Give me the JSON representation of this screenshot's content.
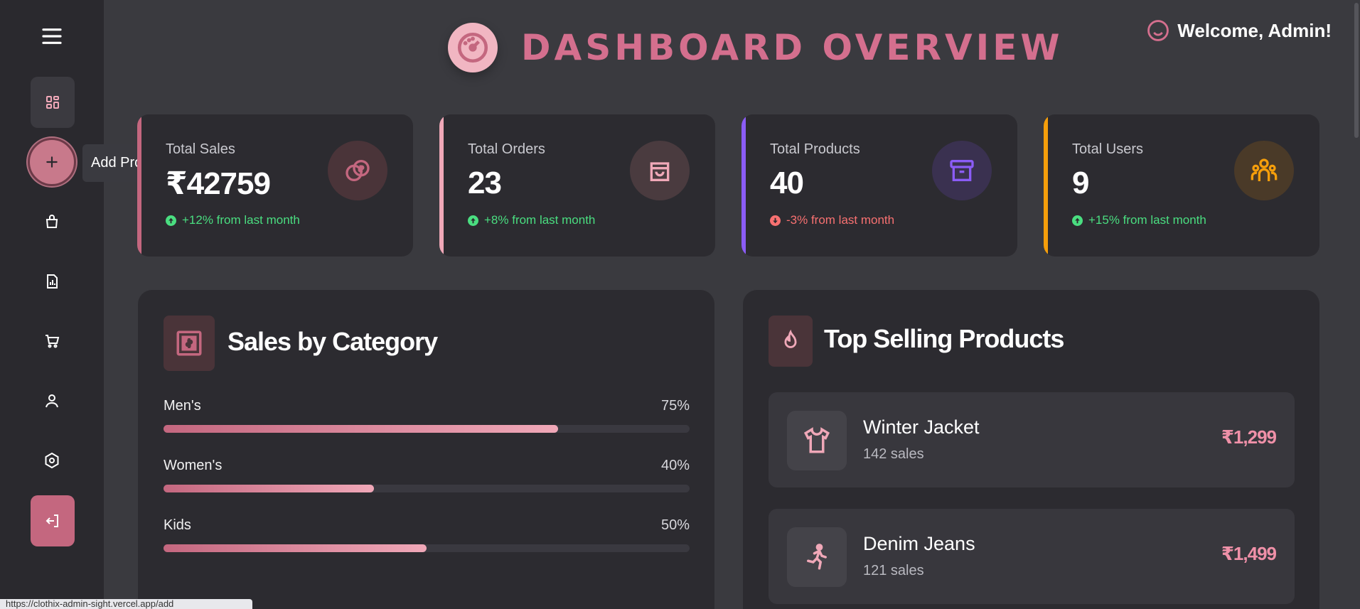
{
  "sidebar": {
    "items": [
      {
        "icon": "menu-icon"
      },
      {
        "icon": "dashboard-icon"
      },
      {
        "icon": "plus-icon",
        "tooltip": "Add Product"
      },
      {
        "icon": "shopping-bag-icon"
      },
      {
        "icon": "report-icon"
      },
      {
        "icon": "cart-icon"
      },
      {
        "icon": "user-icon"
      },
      {
        "icon": "settings-icon"
      },
      {
        "icon": "logout-icon"
      }
    ]
  },
  "header": {
    "title": "DASHBOARD OVERVIEW",
    "welcome": "Welcome, Admin!"
  },
  "stats": [
    {
      "label": "Total Sales",
      "value": "₹42759",
      "change": "+12% from last month",
      "trend": "up",
      "accent": "#c4677f",
      "icon": "coins-icon"
    },
    {
      "label": "Total Orders",
      "value": "23",
      "change": "+8% from last month",
      "trend": "up",
      "accent": "#f0a8b8",
      "icon": "bag-icon"
    },
    {
      "label": "Total Products",
      "value": "40",
      "change": "-3% from last month",
      "trend": "down",
      "accent": "#8b5cf6",
      "icon": "archive-icon"
    },
    {
      "label": "Total Users",
      "value": "9",
      "change": "+15% from last month",
      "trend": "up",
      "accent": "#f59e0b",
      "icon": "users-icon"
    }
  ],
  "sales_by_category": {
    "title": "Sales by Category",
    "items": [
      {
        "name": "Men's",
        "percent": "75%",
        "fill": 0.75
      },
      {
        "name": "Women's",
        "percent": "40%",
        "fill": 0.4
      },
      {
        "name": "Kids",
        "percent": "50%",
        "fill": 0.5
      }
    ]
  },
  "top_selling": {
    "title": "Top Selling Products",
    "items": [
      {
        "name": "Winter Jacket",
        "sales": "142 sales",
        "price": "₹1,299",
        "icon": "shirt-icon"
      },
      {
        "name": "Denim Jeans",
        "sales": "121 sales",
        "price": "₹1,499",
        "icon": "running-icon"
      }
    ]
  },
  "status_bar": {
    "url": "https://clothix-admin-sight.vercel.app/add"
  },
  "colors": {
    "brand": "#c4677f",
    "positive": "#4ade80",
    "negative": "#f87171"
  }
}
